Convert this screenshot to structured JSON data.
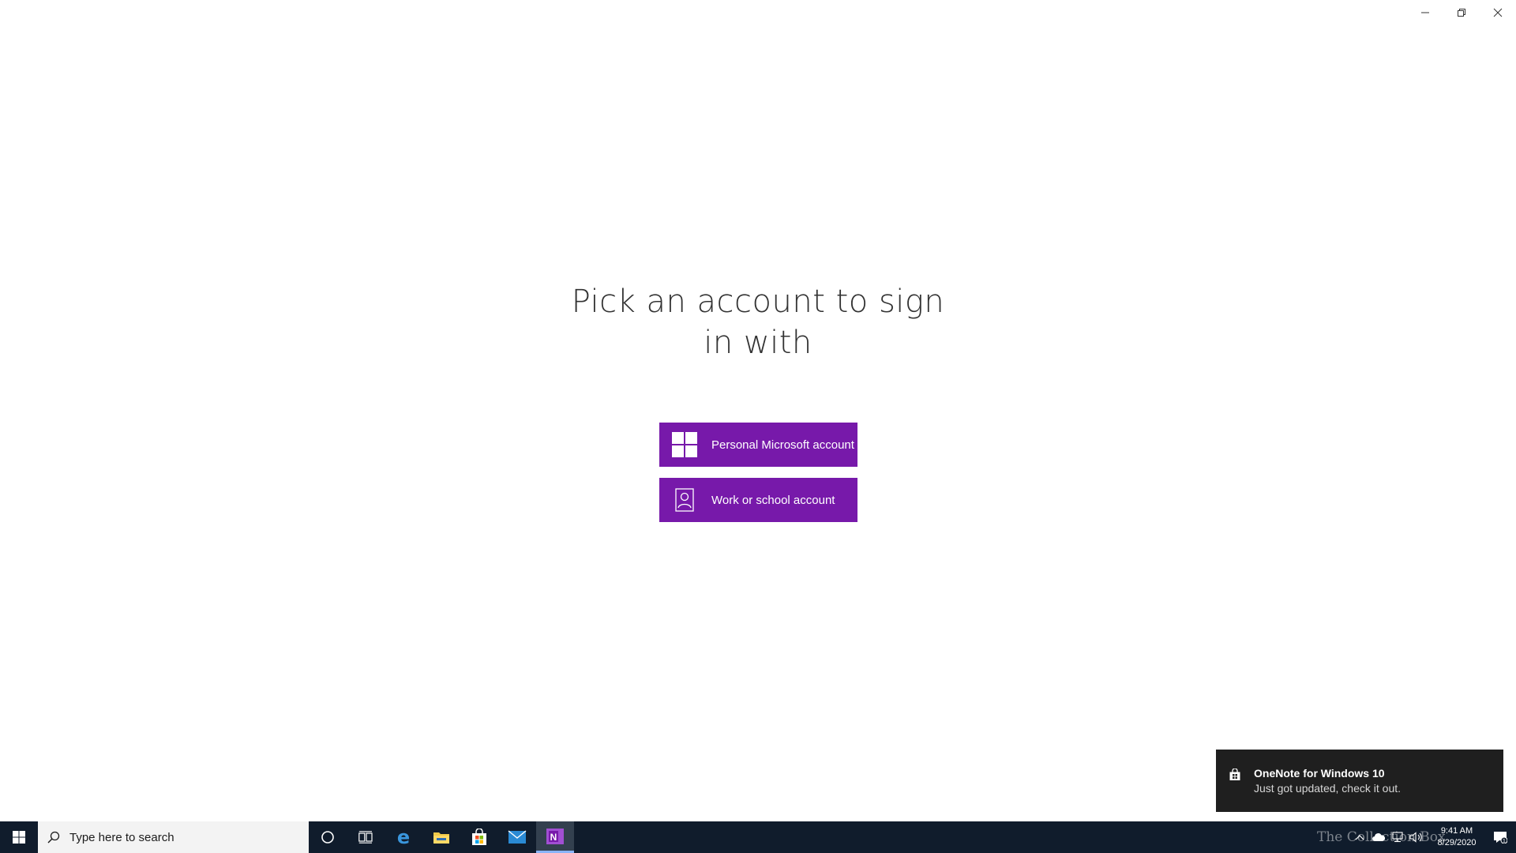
{
  "window": {
    "minimize_icon": "minimize-icon",
    "restore_icon": "restore-icon",
    "close_icon": "close-icon"
  },
  "signin": {
    "heading": "Pick an account to sign in with",
    "buttons": [
      {
        "label": "Personal Microsoft account",
        "icon": "windows-logo-icon"
      },
      {
        "label": "Work or school account",
        "icon": "person-badge-icon"
      }
    ],
    "accent_color": "#7719aa"
  },
  "toast": {
    "title": "OneNote for Windows 10",
    "body": "Just got updated, check it out.",
    "icon": "store-bag-icon"
  },
  "taskbar": {
    "search_placeholder": "Type here to search",
    "pinned": [
      "cortana-icon",
      "task-view-icon",
      "edge-icon",
      "file-explorer-icon",
      "store-icon",
      "mail-icon",
      "onenote-icon"
    ],
    "active_app": "onenote-icon",
    "watermark": "The Collection Box",
    "time": "9:41 AM",
    "date": "8/29/2020",
    "notification_count": "1"
  }
}
